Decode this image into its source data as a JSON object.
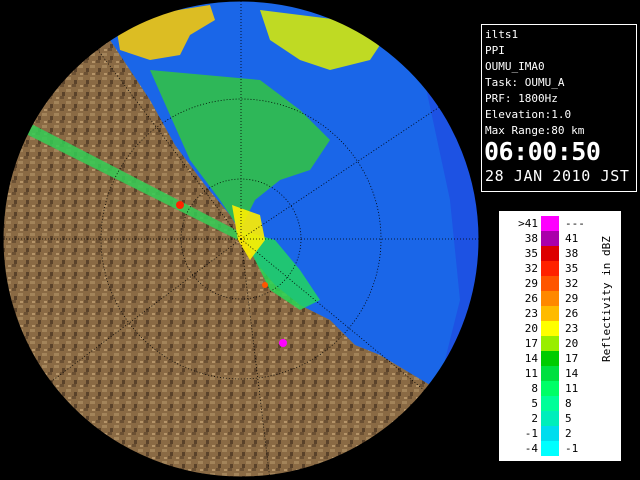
{
  "info": {
    "station": "ilts1",
    "product": "PPI",
    "site": "OUMU_IMA0",
    "task": "Task: OUMU_A",
    "prf": "PRF: 1800Hz",
    "elevation": "Elevation:1.0",
    "max_range": "Max Range:80 km",
    "time": "06:00:50",
    "date": "28 JAN 2010 JST"
  },
  "legend": {
    "unit_label": "Reflectivity in dBZ",
    "rows": [
      {
        "low": ">41",
        "high": "---",
        "color": "#ff00ff"
      },
      {
        "low": "38",
        "high": "41",
        "color": "#aa00aa"
      },
      {
        "low": "35",
        "high": "38",
        "color": "#dd0000"
      },
      {
        "low": "32",
        "high": "35",
        "color": "#ff2200"
      },
      {
        "low": "29",
        "high": "32",
        "color": "#ff5500"
      },
      {
        "low": "26",
        "high": "29",
        "color": "#ff8800"
      },
      {
        "low": "23",
        "high": "26",
        "color": "#ffbb00"
      },
      {
        "low": "20",
        "high": "23",
        "color": "#ffff00"
      },
      {
        "low": "17",
        "high": "20",
        "color": "#99ee00"
      },
      {
        "low": "14",
        "high": "17",
        "color": "#00cc00"
      },
      {
        "low": "11",
        "high": "14",
        "color": "#00e040"
      },
      {
        "low": "8",
        "high": "11",
        "color": "#00ff66"
      },
      {
        "low": "5",
        "high": "8",
        "color": "#00ff99"
      },
      {
        "low": "2",
        "high": "5",
        "color": "#00eebb"
      },
      {
        "low": "-1",
        "high": "2",
        "color": "#00ddee"
      },
      {
        "low": "-4",
        "high": "-1",
        "color": "#00ffff"
      }
    ]
  },
  "colors": {
    "sea": "#1a66e8",
    "sea_outer": "#1f44e0",
    "land": "#8a6a44",
    "background": "#000000"
  }
}
